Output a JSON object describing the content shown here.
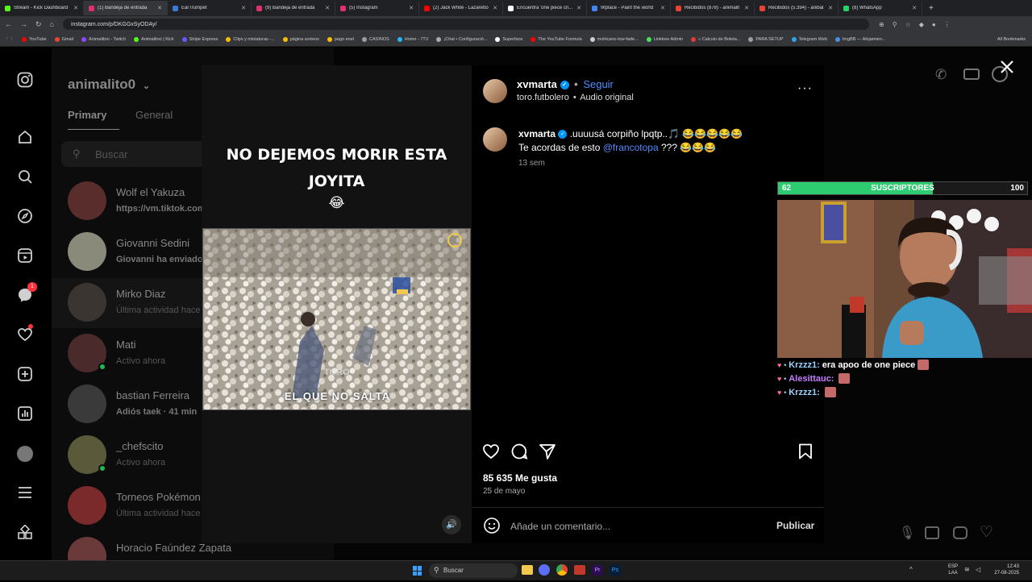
{
  "browser": {
    "tabs": [
      {
        "title": "Stream - Kick Dashboard",
        "color": "#53fc18",
        "active": false
      },
      {
        "title": "(1) Bandeja de entrada",
        "color": "#e1306c",
        "active": true
      },
      {
        "title": "EarTrumpet",
        "color": "#3a7bd5",
        "active": false
      },
      {
        "title": "(9) Bandeja de entrada",
        "color": "#e1306c",
        "active": false
      },
      {
        "title": "(5) Instagram",
        "color": "#e1306c",
        "active": false
      },
      {
        "title": "(2) Jack White - Lazaretto",
        "color": "#ff0000",
        "active": false
      },
      {
        "title": "Encuentra 'one piece cri...",
        "color": "#ffffff",
        "active": false
      },
      {
        "title": "Wplace - Paint the world",
        "color": "#4285f4",
        "active": false
      },
      {
        "title": "Recibidos (878) - animalit",
        "color": "#ea4335",
        "active": false
      },
      {
        "title": "Recibidos (5.394) - anibal",
        "color": "#ea4335",
        "active": false
      },
      {
        "title": "(8) WhatsApp",
        "color": "#25d366",
        "active": false
      }
    ],
    "url": "instagram.com/p/DKGGxSyODAy/",
    "bookmarks": [
      {
        "label": "YouTube",
        "color": "#ff0000"
      },
      {
        "label": "Gmail",
        "color": "#ea4335"
      },
      {
        "label": "Animalitoo - Twitch",
        "color": "#9146ff"
      },
      {
        "label": "Animalitoo | Kick",
        "color": "#53fc18"
      },
      {
        "label": "Stripe Express",
        "color": "#635bff"
      },
      {
        "label": "Clips y miniaturas -...",
        "color": "#fbbc04"
      },
      {
        "label": "página sorteos",
        "color": "#fbbc04"
      },
      {
        "label": "pago enel",
        "color": "#fbbc04"
      },
      {
        "label": "CASINOS",
        "color": "#9aa0a6"
      },
      {
        "label": "Home - 7TV",
        "color": "#29b6f6"
      },
      {
        "label": "¡Chat • Configuració...",
        "color": "#aaaaaa"
      },
      {
        "label": "Superfans",
        "color": "#ffffff"
      },
      {
        "label": "The YouTube Formula",
        "color": "#ff0000"
      },
      {
        "label": "mohicano-low-fade...",
        "color": "#cccccc"
      },
      {
        "label": "Linktree Admin",
        "color": "#43e55e"
      },
      {
        "label": "« Calculo de Boleta...",
        "color": "#e53935"
      },
      {
        "label": "PARA SETUP",
        "color": "#9aa0a6"
      },
      {
        "label": "Telegram Web",
        "color": "#29a9eb"
      },
      {
        "label": "ImgBB — Alojamien...",
        "color": "#4a90e2"
      }
    ],
    "all_bookmarks": "All Bookmarks"
  },
  "dm": {
    "username": "animalito0",
    "tabs": [
      "Primary",
      "General"
    ],
    "search_placeholder": "Buscar",
    "conversations": [
      {
        "name": "Wolf el Yakuza",
        "sub": "https://vm.tiktok.com",
        "online": false,
        "bold": true
      },
      {
        "name": "Giovanni Sedini",
        "sub": "Giovanni ha enviado u",
        "online": false,
        "bold": true
      },
      {
        "name": "Mirko Diaz",
        "sub": "Última actividad hace 3",
        "online": false,
        "bold": false
      },
      {
        "name": "Mati",
        "sub": "Activo ahora",
        "online": true,
        "bold": false
      },
      {
        "name": "bastian Ferreira",
        "sub": "Adiós taek · 41 min",
        "online": false,
        "bold": true
      },
      {
        "name": "_chefscito",
        "sub": "Activo ahora",
        "online": true,
        "bold": false
      },
      {
        "name": "Torneos Pokémon P",
        "sub": "Última actividad hace 2",
        "online": false,
        "bold": false
      },
      {
        "name": "Horacio Faúndez Zapata",
        "sub": "",
        "online": false,
        "bold": false
      }
    ],
    "notif_badge": "1"
  },
  "post": {
    "caption_line1": "NO DEJEMOS MORIR ESTA",
    "caption_line2": "JOYITA",
    "caption_emoji": "😂",
    "video_watermark": "TORO",
    "video_subtitle": "EL QUE NO SALTA",
    "author": "xvmarta",
    "follow": "Seguir",
    "collab": "toro.futbolero",
    "audio": "Audio original",
    "comment_text": ".uuuusá corpiño lpqtp..🎵 😂😂😂😂😂",
    "comment_line2_prefix": "Te acordas de esto",
    "mention": "@francotopa",
    "comment_line2_suffix": "??? 😂😂😂",
    "comment_time": "13 sem",
    "likes": "85 635 Me gusta",
    "date": "25 de mayo",
    "comment_placeholder": "Añade un comentario...",
    "publish": "Publicar"
  },
  "stream": {
    "sub_current": "62",
    "sub_label": "SUSCRIPTORES",
    "sub_goal": "100",
    "sub_progress": 0.62,
    "chat": [
      {
        "user": "Krzzz1:",
        "msg": "era apoo de one piece",
        "color": "#9bd1ff"
      },
      {
        "user": "Alesittauc:",
        "msg": "",
        "color": "#c77dff"
      },
      {
        "user": "Krzzz1:",
        "msg": "",
        "color": "#9bd1ff"
      }
    ]
  },
  "taskbar": {
    "search": "Buscar",
    "lang1": "ESP",
    "lang2": "LAA",
    "time": "12:43",
    "date": "27-08-2025"
  }
}
